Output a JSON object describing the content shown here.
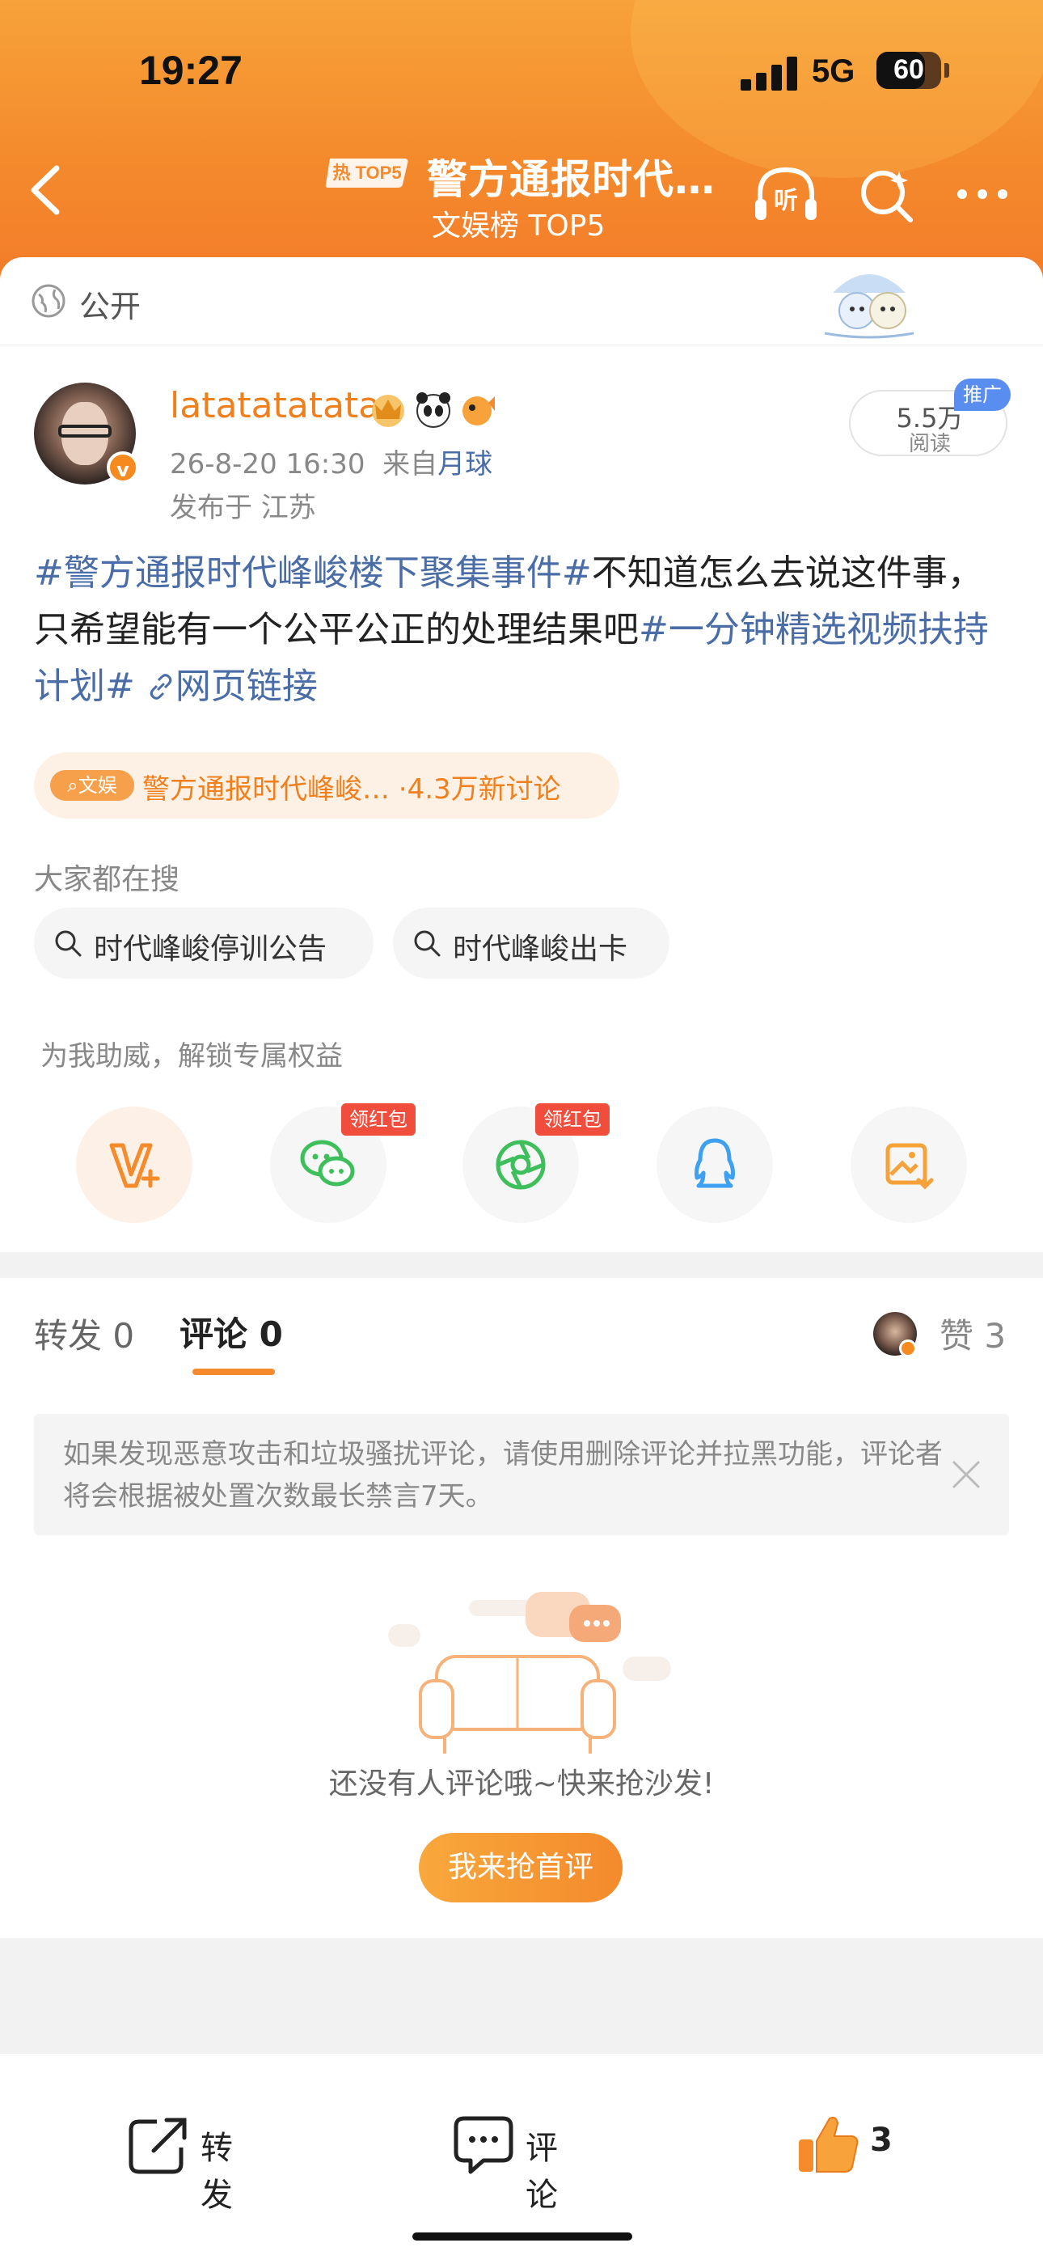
{
  "status_bar": {
    "time": "19:27",
    "network": "5G",
    "battery": "60"
  },
  "nav": {
    "hot_badge": "热 TOP5",
    "title": "警方通报时代…",
    "subtitle": "文娱榜 TOP5"
  },
  "visibility": {
    "label": "公开"
  },
  "post": {
    "username": "latatatatata",
    "date": "26-8-20 16:30",
    "source_prefix": "来自",
    "source": "月球",
    "location": "发布于 江苏",
    "reads_count": "5.5万",
    "reads_label": "阅读",
    "promo_badge": "推广",
    "tag1": "#警方通报时代峰峻楼下聚集事件#",
    "body": "不知道怎么去说这件事，只希望能有一个公平公正的处理结果吧",
    "tag2": "#一分钟精选视频扶持计划#",
    "link_text": "网页链接"
  },
  "topic_chip": {
    "badge": "文娱",
    "text": "警方通报时代峰峻…  ·4.3万新讨论"
  },
  "search_suggest": {
    "title": "大家都在搜",
    "items": [
      "时代峰峻停训公告",
      "时代峰峻出卡"
    ]
  },
  "share": {
    "help_text": "为我助威，解锁专属权益",
    "redpack_label": "领红包"
  },
  "tabs": {
    "repost_label": "转发",
    "repost_count": "0",
    "comment_label": "评论",
    "comment_count": "0",
    "like_label": "赞",
    "like_count": "3"
  },
  "notice": {
    "text": "如果发现恶意攻击和垃圾骚扰评论，请使用删除评论并拉黑功能，评论者将会根据被处置次数最长禁言7天。"
  },
  "empty": {
    "message": "还没有人评论哦~快来抢沙发!",
    "button": "我来抢首评"
  },
  "bottom_bar": {
    "repost": "转发",
    "comment": "评论",
    "like_count": "3"
  },
  "colors": {
    "accent": "#f58b2a",
    "link": "#4a6da7",
    "header_top": "#f7a23a"
  }
}
